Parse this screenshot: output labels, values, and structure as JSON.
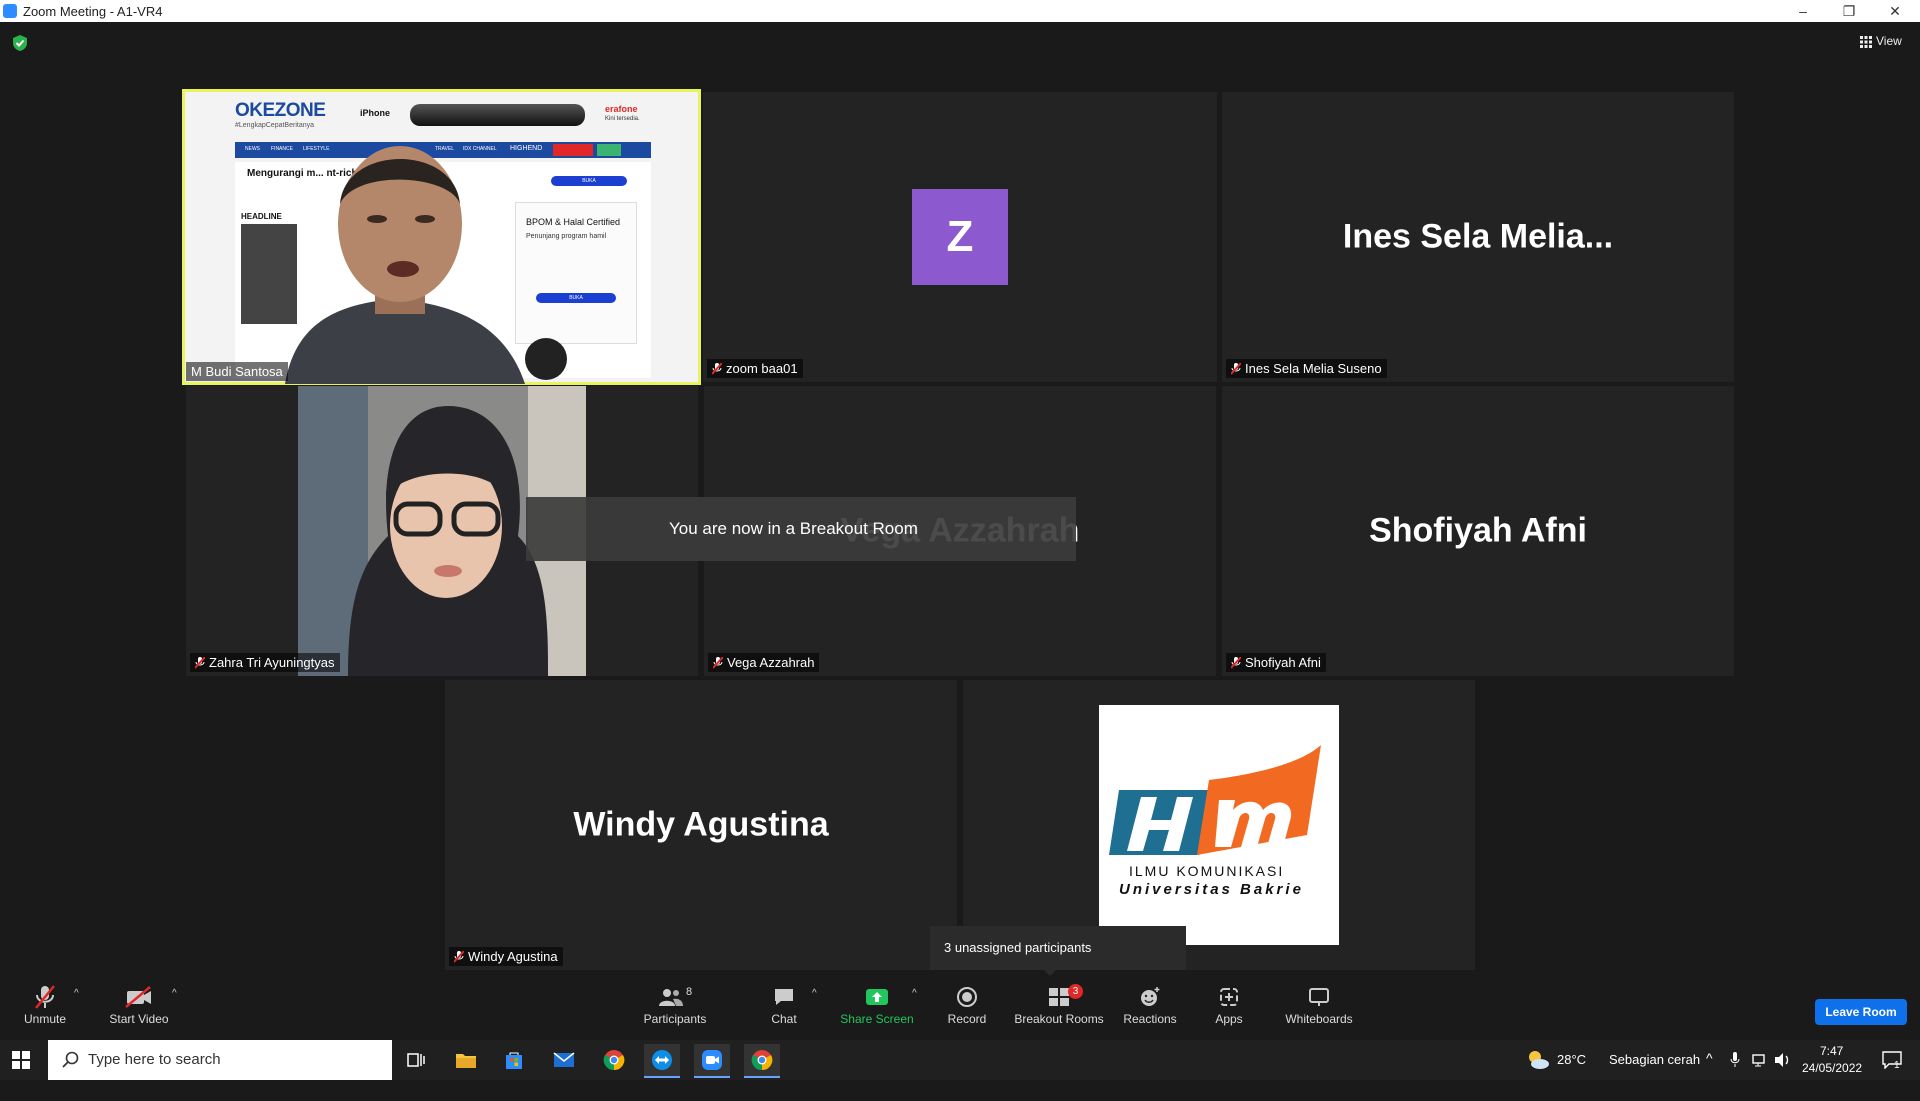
{
  "window": {
    "title": "Zoom Meeting - A1-VR4"
  },
  "header": {
    "view_label": "View"
  },
  "tiles": [
    {
      "id": "m-budi",
      "name": "M Budi Santosa",
      "muted": false,
      "active": true
    },
    {
      "id": "zoom-baa01",
      "name": "zoom baa01",
      "muted": true,
      "avatar_letter": "Z"
    },
    {
      "id": "ines",
      "name": "Ines Sela Melia Suseno",
      "muted": true,
      "display_name": "Ines Sela Melia..."
    },
    {
      "id": "zahra",
      "name": "Zahra Tri Ayuningtyas",
      "muted": true
    },
    {
      "id": "vega",
      "name": "Vega Azzahrah",
      "muted": true,
      "display_name": "Vega Azzahrah"
    },
    {
      "id": "shofiyah",
      "name": "Shofiyah Afni",
      "muted": true,
      "display_name": "Shofiyah Afni"
    },
    {
      "id": "windy",
      "name": "Windy Agustina",
      "muted": true,
      "display_name": "Windy Agustina"
    },
    {
      "id": "logo-tile",
      "logo_line1": "ILMU KOMUNIKASI",
      "logo_line2": "Universitas Bakrie"
    }
  ],
  "screen_share": {
    "site_logo": "OKEZONE",
    "tagline": "#LengkapCepatBeritanya",
    "ad_brand": "iPhone",
    "ad_store": "erafone",
    "ad_sub": "Kini tersedia.",
    "nav": [
      "NEWS",
      "FINANCE",
      "LIFESTYLE",
      "TRAVEL",
      "IDX CHANNEL",
      "HIGHEND"
    ],
    "headline_label": "HEADLINE",
    "ad_title": "Mengurangi m... nt-rich hydration drink",
    "ad_box_title": "BPOM & Halal Certified",
    "ad_box_sub": "Penunjang program hamil",
    "buka": "BUKA"
  },
  "notice": {
    "breakout": "You are now in a Breakout Room"
  },
  "tooltip": {
    "text": "3 unassigned participants"
  },
  "toolbar": {
    "unmute": "Unmute",
    "start_video": "Start Video",
    "participants": "Participants",
    "participants_count": "8",
    "chat": "Chat",
    "share_screen": "Share Screen",
    "record": "Record",
    "breakout_rooms": "Breakout Rooms",
    "breakout_badge": "3",
    "reactions": "Reactions",
    "apps": "Apps",
    "whiteboards": "Whiteboards",
    "leave_room": "Leave Room"
  },
  "taskbar": {
    "search_placeholder": "Type here to search",
    "weather_temp": "28°C",
    "weather_text": "Sebagian cerah",
    "time": "7:47",
    "date": "24/05/2022",
    "notif_count": "1"
  },
  "colors": {
    "accent": "#0e71eb",
    "active_speaker": "#e9f35d",
    "avatar": "#8c59cf",
    "share_green": "#22c55e",
    "mute_red": "#e02828"
  }
}
